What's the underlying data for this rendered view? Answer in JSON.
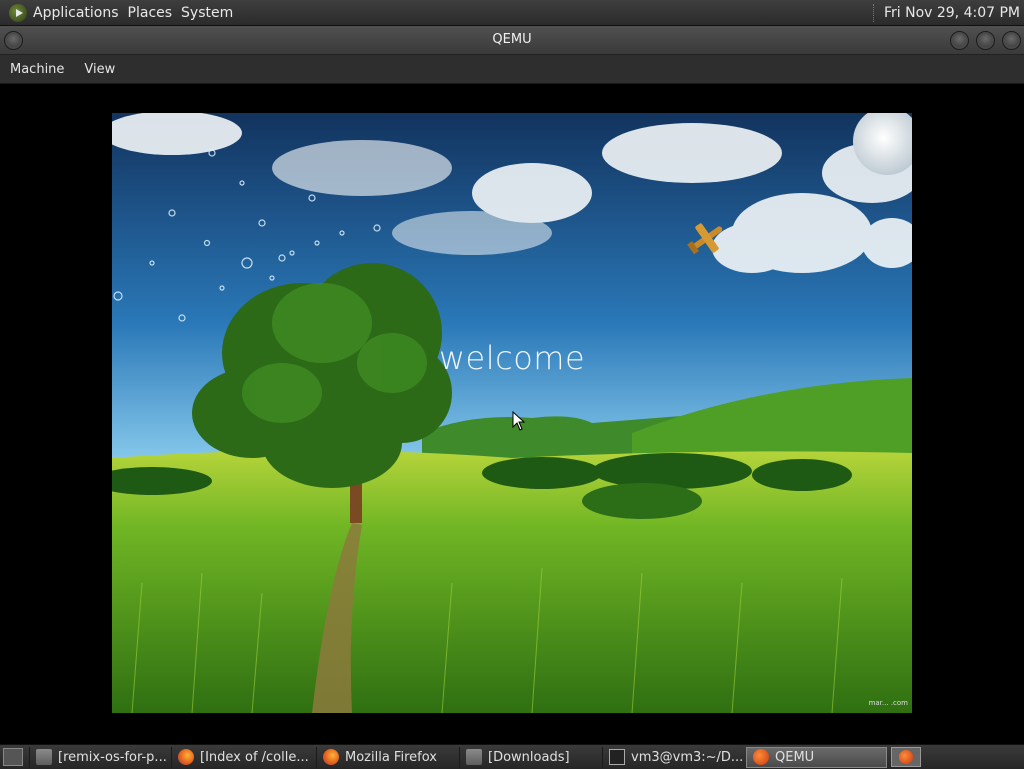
{
  "top_panel": {
    "menus": [
      "Applications",
      "Places",
      "System"
    ],
    "clock": "Fri Nov 29,  4:07 PM"
  },
  "window": {
    "title": "QEMU",
    "menus": [
      "Machine",
      "View"
    ]
  },
  "guest": {
    "welcome_text": "welcome",
    "watermark": "mar... .com"
  },
  "taskbar": {
    "tasks": [
      {
        "label": "[remix-os-for-p...",
        "icon": "folder-icon"
      },
      {
        "label": "[Index of /colle...",
        "icon": "firefox-icon"
      },
      {
        "label": "Mozilla Firefox",
        "icon": "firefox-icon"
      },
      {
        "label": "[Downloads]",
        "icon": "folder-icon"
      },
      {
        "label": "vm3@vm3:~/D...",
        "icon": "terminal-icon"
      },
      {
        "label": "QEMU",
        "icon": "qemu-icon",
        "active": true
      }
    ]
  },
  "colors": {
    "panel_bg": "#333333",
    "sky_top": "#1d4f86",
    "grass": "#5ea81e"
  }
}
